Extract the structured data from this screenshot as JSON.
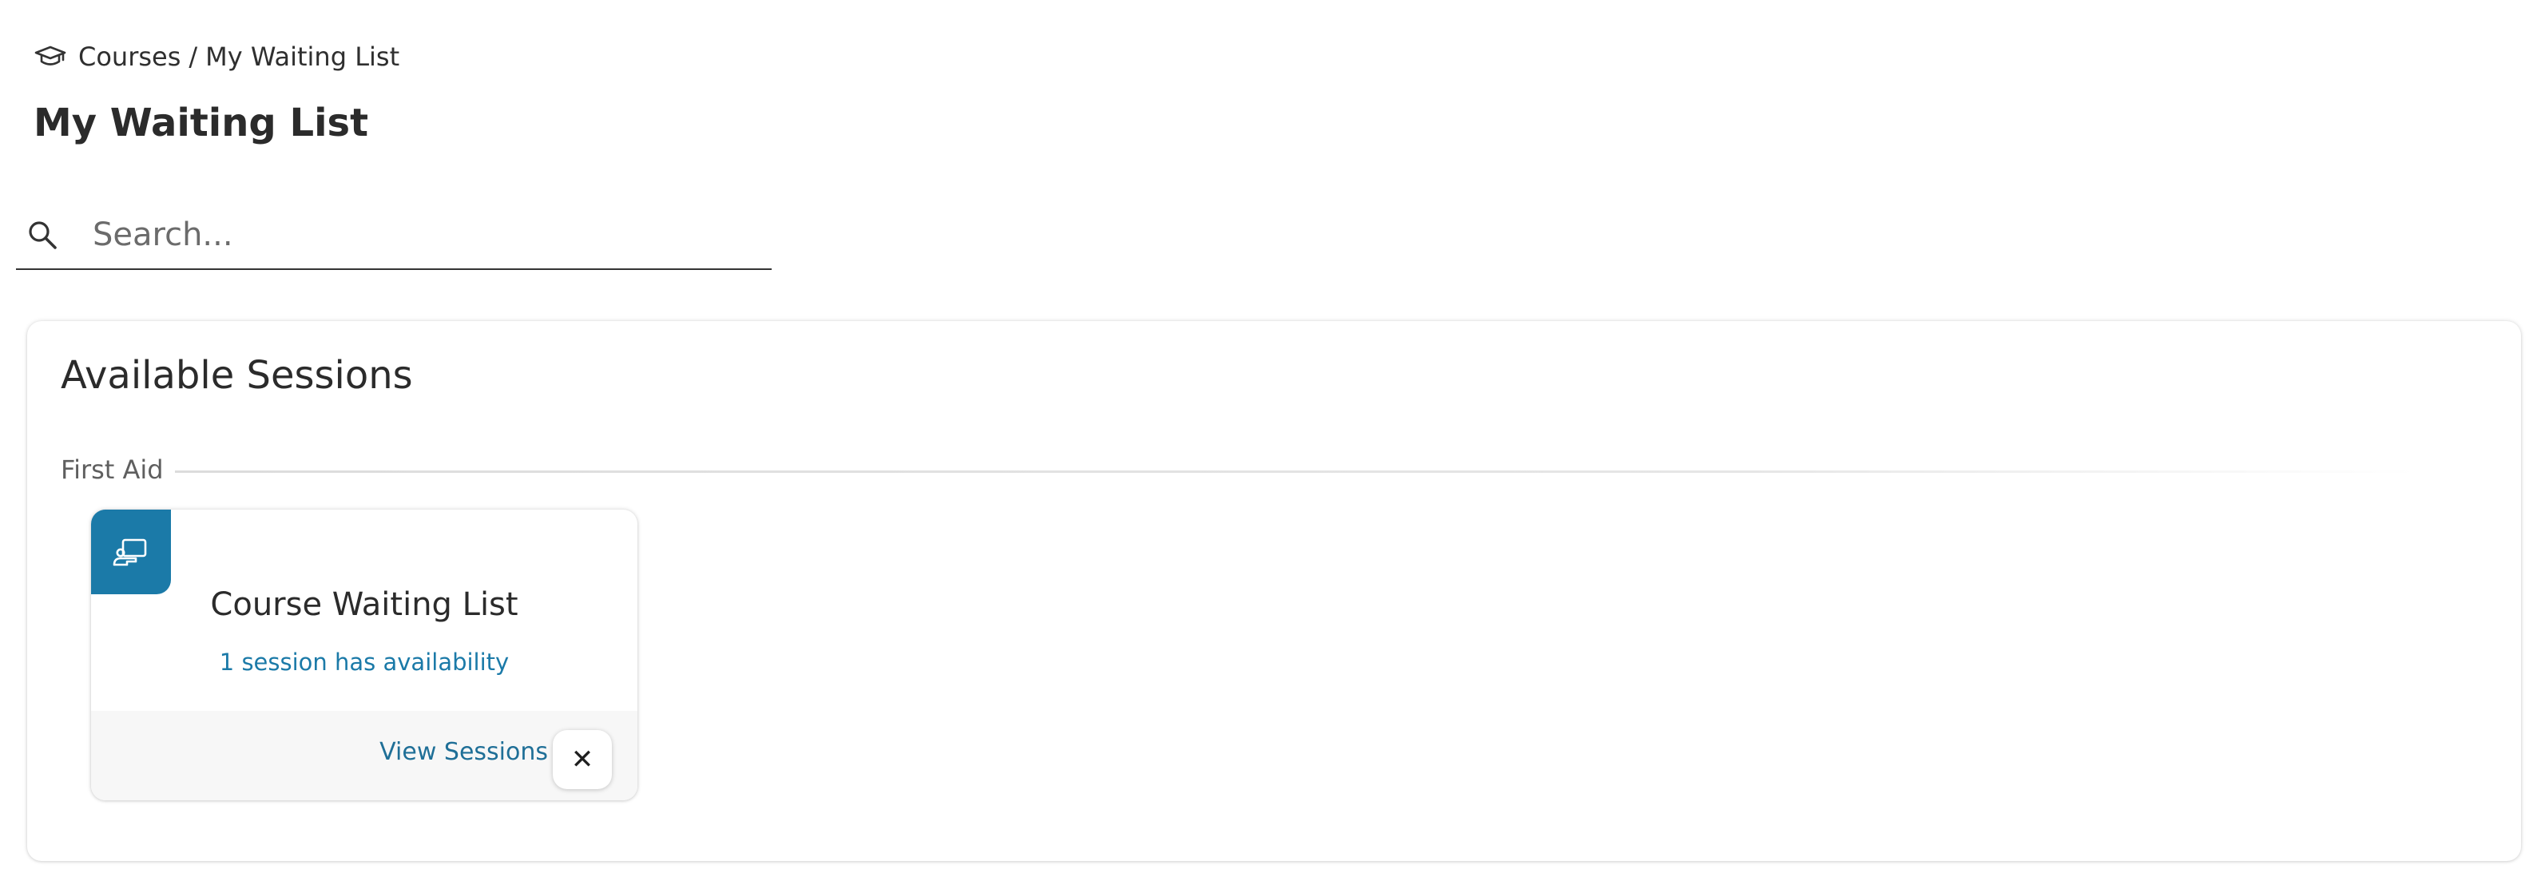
{
  "breadcrumb": {
    "icon": "graduation-cap-icon",
    "root": "Courses",
    "separator": "/",
    "current": "My Waiting List"
  },
  "page": {
    "title": "My Waiting List"
  },
  "search": {
    "icon": "search-icon",
    "placeholder": "Search...",
    "value": ""
  },
  "panel": {
    "title": "Available Sessions",
    "groups": [
      {
        "label": "First Aid",
        "cards": [
          {
            "badge_icon": "presentation-board-icon",
            "badge_color": "#1b7aa8",
            "title": "Course Waiting List",
            "subtitle": "1 session has availability",
            "action_label": "View Sessions",
            "remove_glyph": "✕"
          }
        ]
      }
    ]
  },
  "colors": {
    "accent": "#1b7aa8",
    "link": "#1f6f97",
    "text": "#2b2b2b"
  }
}
